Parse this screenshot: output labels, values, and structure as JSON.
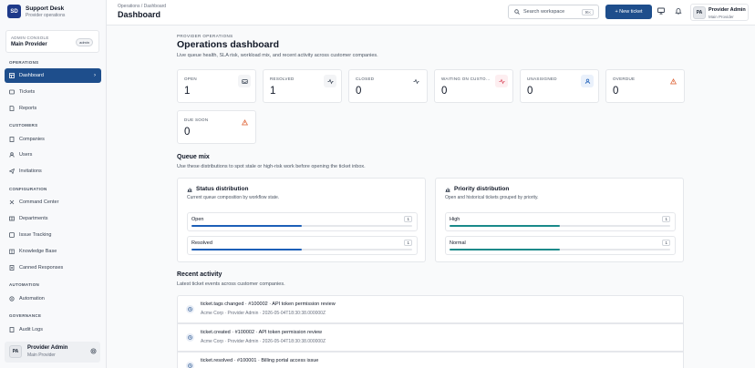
{
  "brand": {
    "logo": "SD",
    "title": "Support Desk",
    "subtitle": "Provider operations"
  },
  "console": {
    "label": "ADMIN CONSOLE",
    "value": "Main Provider",
    "badge": "admin"
  },
  "nav": {
    "operations": "OPERATIONS",
    "dashboard": "Dashboard",
    "tickets": "Tickets",
    "reports": "Reports",
    "customers": "CUSTOMERS",
    "companies": "Companies",
    "users": "Users",
    "invitations": "Invitations",
    "configuration": "CONFIGURATION",
    "command_center": "Command Center",
    "departments": "Departments",
    "issue_tracking": "Issue Tracking",
    "knowledge_base": "Knowledge Base",
    "canned_responses": "Canned Responses",
    "automation_section": "AUTOMATION",
    "automation": "Automation",
    "governance": "GOVERNANCE",
    "audit_logs": "Audit Logs"
  },
  "profile": {
    "initials": "PA",
    "name": "Provider Admin",
    "org": "Main Provider"
  },
  "topbar": {
    "breadcrumb": "Operations / Dashboard",
    "title": "Dashboard",
    "search_placeholder": "Search workspace",
    "shortcut": "⌘K",
    "new_ticket": "+ New ticket"
  },
  "header": {
    "eyebrow": "PROVIDER OPERATIONS",
    "title": "Operations dashboard",
    "lead": "Live queue health, SLA risk, workload mix, and recent activity across customer companies."
  },
  "stats": [
    {
      "label": "OPEN",
      "value": "1"
    },
    {
      "label": "RESOLVED",
      "value": "1"
    },
    {
      "label": "CLOSED",
      "value": "0"
    },
    {
      "label": "WAITING ON CUSTOMER",
      "value": "0"
    },
    {
      "label": "UNASSIGNED",
      "value": "0"
    },
    {
      "label": "OVERDUE",
      "value": "0"
    },
    {
      "label": "DUE SOON",
      "value": "0"
    }
  ],
  "queue": {
    "title": "Queue mix",
    "subtitle": "Use these distributions to spot stale or high-risk work before opening the ticket inbox.",
    "status": {
      "title": "Status distribution",
      "subtitle": "Current queue composition by workflow state.",
      "rows": [
        {
          "label": "Open",
          "count": "1",
          "fraction": 0.5
        },
        {
          "label": "Resolved",
          "count": "1",
          "fraction": 0.5
        }
      ]
    },
    "priority": {
      "title": "Priority distribution",
      "subtitle": "Open and historical tickets grouped by priority.",
      "rows": [
        {
          "label": "High",
          "count": "1",
          "fraction": 0.5
        },
        {
          "label": "Normal",
          "count": "1",
          "fraction": 0.5
        }
      ]
    }
  },
  "activity": {
    "title": "Recent activity",
    "subtitle": "Latest ticket events across customer companies.",
    "items": [
      {
        "title": "ticket.tags changed · #100002 · API token permission review",
        "meta": "Acme Corp · Provider Admin · 2026-05-04T18:30:38.000000Z"
      },
      {
        "title": "ticket.created · #100002 · API token permission review",
        "meta": "Acme Corp · Provider Admin · 2026-05-04T18:30:38.000000Z"
      },
      {
        "title": "ticket.resolved · #100001 · Billing portal access issue",
        "meta": ""
      }
    ]
  },
  "colors": {
    "primary": "#1e4e8c",
    "status_bar": "#1d5fb8",
    "priority_bar": "#1a8a8a",
    "warning": "#dc5a2a",
    "danger": "#d9465a"
  }
}
